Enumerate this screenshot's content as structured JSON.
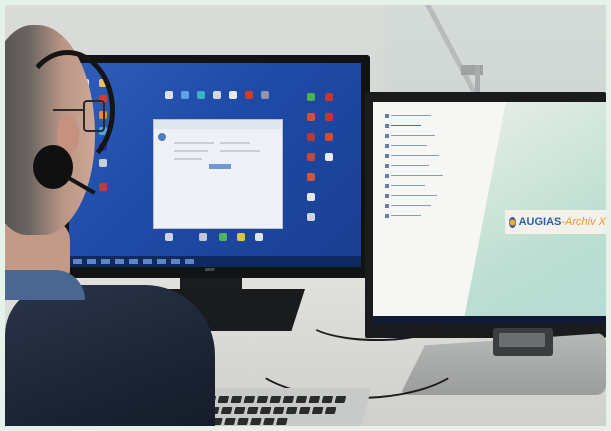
{
  "scene": {
    "left_monitor": {
      "brand": "acer",
      "screen_color": "#2457b4"
    },
    "right_monitor": {
      "logo": {
        "word1": "AUGIAS",
        "word2": "Archiv X"
      },
      "logo_colors": {
        "primary": "#2a5ea8",
        "accent": "#e89a2a"
      }
    }
  }
}
